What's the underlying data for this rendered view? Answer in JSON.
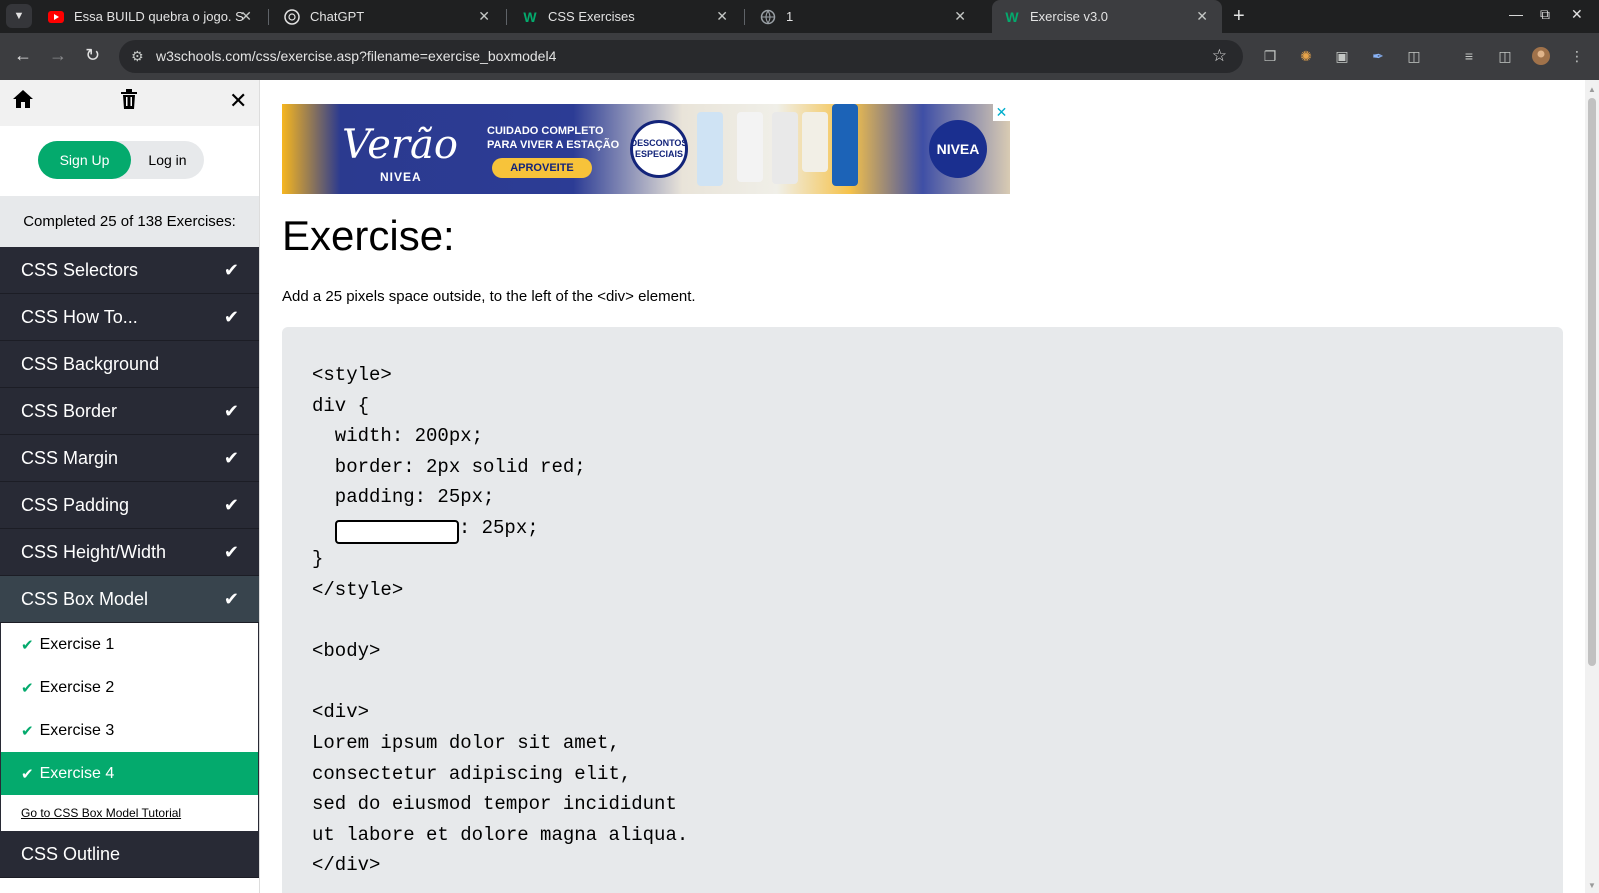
{
  "browser": {
    "tabs": [
      {
        "title": "Essa BUILD quebra o jogo. S",
        "favicon": "youtube-icon",
        "active": false
      },
      {
        "title": "ChatGPT",
        "favicon": "chatgpt-icon",
        "active": false
      },
      {
        "title": "CSS Exercises",
        "favicon": "w3schools-icon",
        "active": false
      },
      {
        "title": "1",
        "favicon": "globe-icon",
        "active": false
      },
      {
        "title": "Exercise v3.0",
        "favicon": "w3schools-icon",
        "active": true
      }
    ],
    "url": "w3schools.com/css/exercise.asp?filename=exercise_boxmodel4"
  },
  "sidebar": {
    "signup_label": "Sign Up",
    "login_label": "Log in",
    "progress_text": "Completed 25 of 138 Exercises:",
    "categories_before": [
      {
        "label": "CSS Selectors",
        "completed": true
      },
      {
        "label": "CSS How To...",
        "completed": true
      },
      {
        "label": "CSS Background",
        "completed": false
      },
      {
        "label": "CSS Border",
        "completed": true
      },
      {
        "label": "CSS Margin",
        "completed": true
      },
      {
        "label": "CSS Padding",
        "completed": true
      },
      {
        "label": "CSS Height/Width",
        "completed": true
      }
    ],
    "current_category": {
      "label": "CSS Box Model",
      "completed": true
    },
    "exercises": [
      {
        "label": "Exercise 1",
        "completed": true
      },
      {
        "label": "Exercise 2",
        "completed": true
      },
      {
        "label": "Exercise 3",
        "completed": true
      },
      {
        "label": "Exercise 4",
        "completed": true
      }
    ],
    "tutorial_link": "Go to CSS Box Model Tutorial",
    "categories_after": [
      {
        "label": "CSS Outline",
        "completed": false
      }
    ]
  },
  "ad": {
    "brand": "Verão",
    "sub_brand": "NIVEA",
    "headline": "CUIDADO COMPLETO PARA VIVER A ESTAÇÃO",
    "cta": "APROVEITE",
    "badge_line1": "DESCONTOS",
    "badge_line2": "ESPECIAIS",
    "logo": "NIVEA",
    "colors": {
      "primary": "#2c3c95",
      "accent": "#f7c33a"
    }
  },
  "main": {
    "title": "Exercise:",
    "instruction": "Add a 25 pixels space outside, to the left of the <div> element.",
    "code_lines_before": [
      "<style>",
      "div {",
      "  width: 200px;",
      "  border: 2px solid red;",
      "  padding: 25px;"
    ],
    "input_line_suffix": ": 25px;",
    "input_value": "",
    "code_lines_after": [
      "}",
      "</style>",
      "",
      "<body>",
      "",
      "<div>",
      "Lorem ipsum dolor sit amet,",
      "consectetur adipiscing elit,",
      "sed do eiusmod tempor incididunt",
      "ut labore et dolore magna aliqua.",
      "</div>"
    ]
  },
  "colors": {
    "w3_green": "#04aa6d",
    "sidebar_dark": "#282a35",
    "code_bg": "#e7e9eb"
  }
}
